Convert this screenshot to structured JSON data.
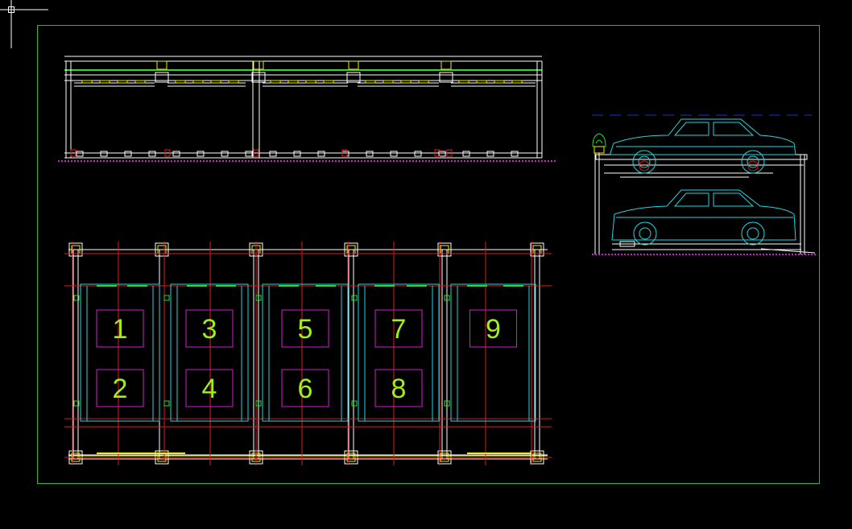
{
  "drawing": {
    "background_color": "#000000",
    "border_color": "#19c719",
    "colors": {
      "white": "#ffffff",
      "red": "#e01a1a",
      "yellow": "#f0f000",
      "green": "#22e022",
      "cyan": "#1fd8e0",
      "magenta": "#d21bd2",
      "blue": "#2030d0",
      "slot_number": "#9ff01a"
    },
    "cursor_icon": "crosshair-icon"
  },
  "plan_view": {
    "slots": [
      {
        "top": "1",
        "bottom": "2"
      },
      {
        "top": "3",
        "bottom": "4"
      },
      {
        "top": "5",
        "bottom": "6"
      },
      {
        "top": "7",
        "bottom": "8"
      },
      {
        "top": "9",
        "bottom": ""
      }
    ]
  }
}
